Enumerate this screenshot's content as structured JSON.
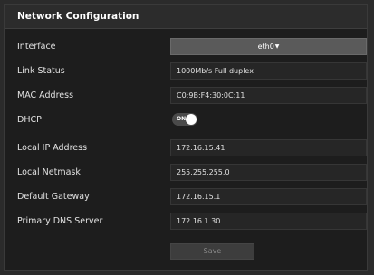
{
  "panel": {
    "title": "Network Configuration"
  },
  "fields": {
    "interface": {
      "label": "Interface",
      "value": "eth0"
    },
    "link_status": {
      "label": "Link Status",
      "value": "1000Mb/s Full duplex"
    },
    "mac_address": {
      "label": "MAC Address",
      "value": "C0:9B:F4:30:0C:11"
    },
    "dhcp": {
      "label": "DHCP",
      "toggle_text": "ON",
      "enabled": true
    },
    "local_ip": {
      "label": "Local IP Address",
      "value": "172.16.15.41"
    },
    "local_netmask": {
      "label": "Local Netmask",
      "value": "255.255.255.0"
    },
    "default_gateway": {
      "label": "Default Gateway",
      "value": "172.16.15.1"
    },
    "primary_dns": {
      "label": "Primary DNS Server",
      "value": "172.16.1.30"
    }
  },
  "actions": {
    "save_label": "Save"
  },
  "icons": {
    "dropdown": "caret-down-icon"
  },
  "colors": {
    "background": "#1d1d1d",
    "header": "#2c2c2c",
    "select": "#5a5a5a",
    "field": "#262626",
    "save_button": "#3d3d3d"
  }
}
